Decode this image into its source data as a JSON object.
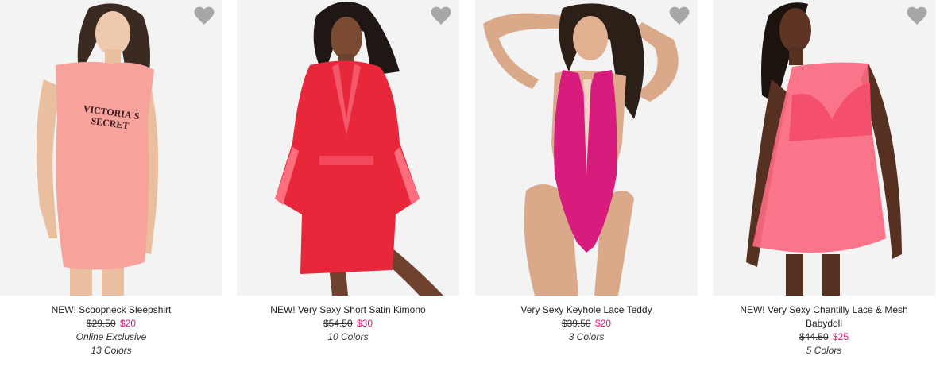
{
  "products": [
    {
      "name": "NEW! Scoopneck Sleepshirt",
      "old_price": "$29.50",
      "sale_price": "$20",
      "badge": "Online Exclusive",
      "colors": "13 Colors",
      "photo_alt": "Model wearing pink Victoria's Secret sleepshirt",
      "garment_color": "#f7a39c"
    },
    {
      "name": "NEW! Very Sexy Short Satin Kimono",
      "old_price": "$54.50",
      "sale_price": "$30",
      "badge": "",
      "colors": "10 Colors",
      "photo_alt": "Model wearing red satin kimono",
      "garment_color": "#e8283a"
    },
    {
      "name": "Very Sexy Keyhole Lace Teddy",
      "old_price": "$39.50",
      "sale_price": "$20",
      "badge": "",
      "colors": "3 Colors",
      "photo_alt": "Model wearing pink lace teddy",
      "garment_color": "#d81c7e"
    },
    {
      "name": "NEW! Very Sexy Chantilly Lace & Mesh Babydoll",
      "old_price": "$44.50",
      "sale_price": "$25",
      "badge": "",
      "colors": "5 Colors",
      "photo_alt": "Model wearing coral lace and mesh babydoll",
      "garment_color": "#fb6a80"
    }
  ],
  "colors": {
    "sale": "#d6197a",
    "heart": "#a7a7a7",
    "photo_bg": "#f2f2f2"
  },
  "icons": {
    "favorite": "heart-icon"
  }
}
